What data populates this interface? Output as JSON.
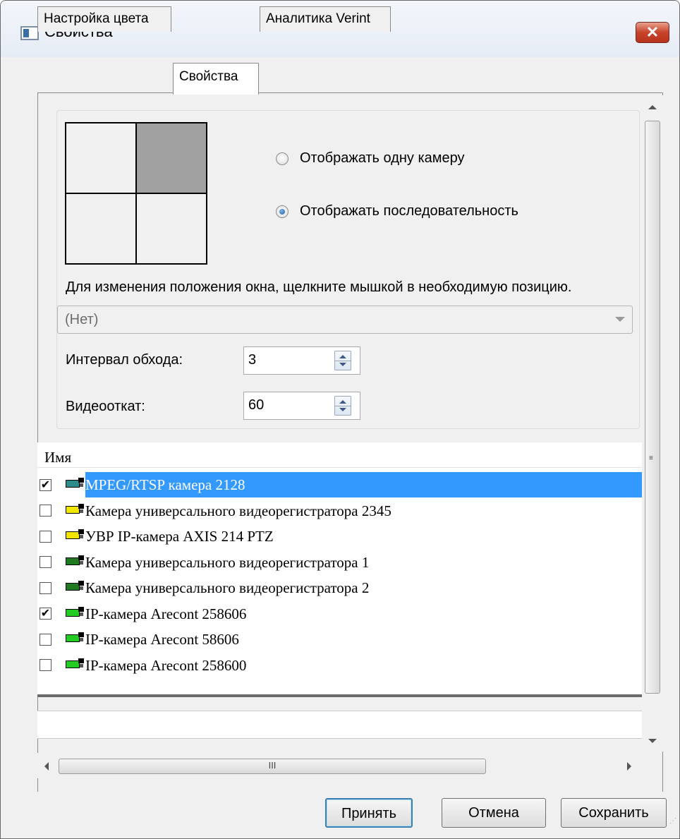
{
  "window": {
    "title": "Свойства",
    "close_label": "✕"
  },
  "tabs": [
    {
      "label": "Настройка цвета",
      "active": false
    },
    {
      "label": "Свойства",
      "active": true
    },
    {
      "label": "Аналитика Verint",
      "active": false
    }
  ],
  "layout_picker": {
    "selected_cell": 2,
    "radio_single": {
      "label": "Отображать одну камеру",
      "checked": false
    },
    "radio_sequence": {
      "label": "Отображать последовательность",
      "checked": true
    },
    "hint": "Для изменения положения окна, щелкните мышкой в необходимую позицию.",
    "combo_value": "(Нет)"
  },
  "fields": {
    "interval": {
      "label": "Интервал обхода:",
      "value": "3"
    },
    "rollback": {
      "label": "Видеооткат:",
      "value": "60"
    }
  },
  "camera_list": {
    "column_header": "Имя",
    "items": [
      {
        "label": "MPEG/RTSP камера 2128",
        "checked": true,
        "selected": true,
        "icon_color": "#2e8b8b"
      },
      {
        "label": "Камера универсального видеорегистратора 2345",
        "checked": false,
        "selected": false,
        "icon_color": "#f2e600"
      },
      {
        "label": "УВР IP-камера AXIS 214 PTZ",
        "checked": false,
        "selected": false,
        "icon_color": "#f2e600"
      },
      {
        "label": "Камера универсального видеорегистратора 1",
        "checked": false,
        "selected": false,
        "icon_color": "#1f7a1f"
      },
      {
        "label": "Камера универсального видеорегистратора 2",
        "checked": false,
        "selected": false,
        "icon_color": "#1f7a1f"
      },
      {
        "label": "IP-камера Arecont 258606",
        "checked": true,
        "selected": false,
        "icon_color": "#22cc22"
      },
      {
        "label": "IP-камера Arecont 58606",
        "checked": false,
        "selected": false,
        "icon_color": "#22cc22"
      },
      {
        "label": "IP-камера Arecont 258600",
        "checked": false,
        "selected": false,
        "icon_color": "#22cc22"
      }
    ]
  },
  "scrollbars": {
    "vertical_grip": "≡",
    "horizontal_grip": "III"
  },
  "buttons": {
    "accept": "Принять",
    "cancel": "Отмена",
    "save": "Сохранить"
  },
  "colors": {
    "selection": "#3399ff",
    "window_bg": "#f0f0f0",
    "close_red": "#c7442a"
  }
}
